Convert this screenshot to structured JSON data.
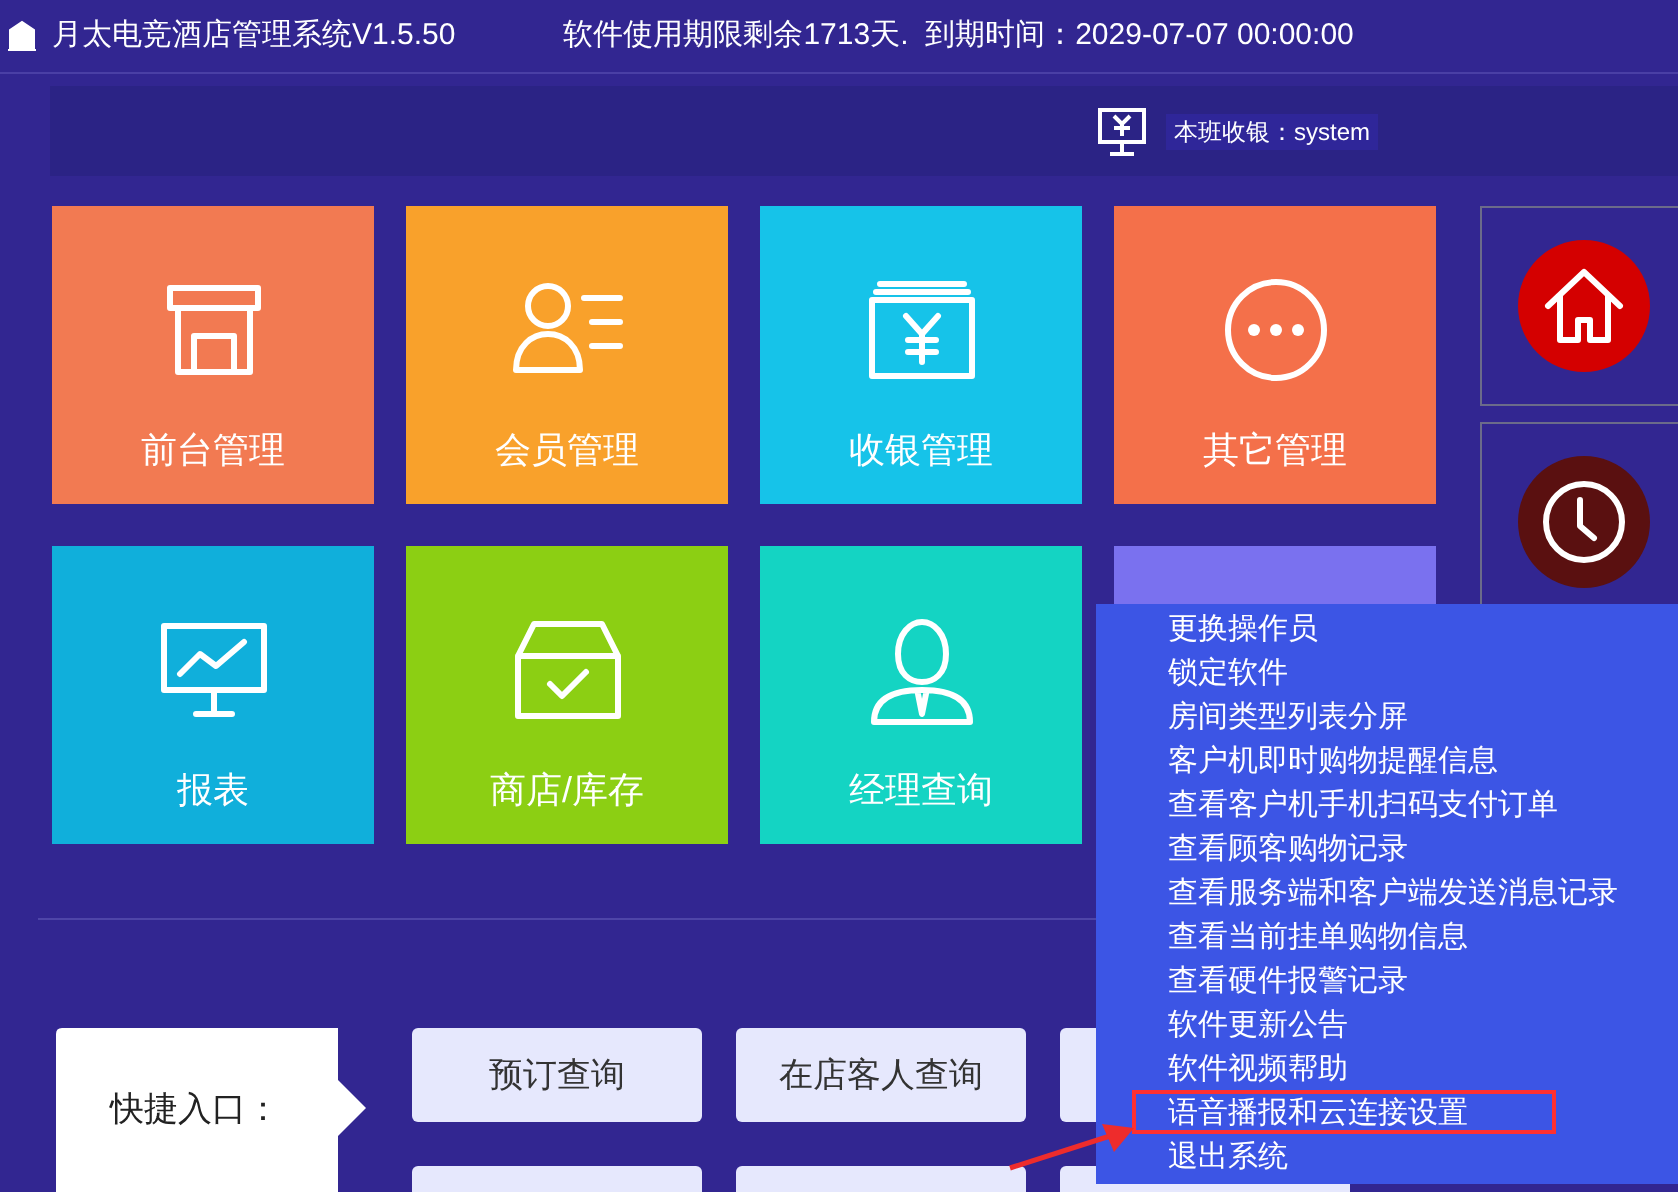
{
  "window": {
    "title": "月太电竞酒店管理系统V1.5.50",
    "license": "软件使用期限剩余1713天.  到期时间：2029-07-07 00:00:00"
  },
  "toolbar": {
    "cashier": "本班收银：system"
  },
  "tiles": [
    {
      "kind": "frontdesk",
      "label": "前台管理",
      "color": "#f27a52"
    },
    {
      "kind": "member",
      "label": "会员管理",
      "color": "#f9a12b"
    },
    {
      "kind": "cashier",
      "label": "收银管理",
      "color": "#16c3e9"
    },
    {
      "kind": "other",
      "label": "其它管理",
      "color": "#f4704a"
    },
    {
      "kind": "report",
      "label": "报表",
      "color": "#10afdb"
    },
    {
      "kind": "store",
      "label": "商店/库存",
      "color": "#8ccf13"
    },
    {
      "kind": "manager",
      "label": "经理查询",
      "color": "#14d4c3"
    },
    {
      "kind": "blank",
      "color": "#7a71ef"
    }
  ],
  "side_cards": [
    {
      "kind": "home",
      "color": "#d40000"
    },
    {
      "kind": "clock",
      "color": "#5a1010"
    }
  ],
  "quick_entry": {
    "label": "快捷入口：",
    "buttons": [
      "预订查询",
      "在店客人查询"
    ]
  },
  "menu": {
    "items": [
      {
        "label": "更换操作员",
        "highlighted": false
      },
      {
        "label": "锁定软件",
        "highlighted": false
      },
      {
        "label": "房间类型列表分屏",
        "highlighted": false
      },
      {
        "label": "客户机即时购物提醒信息",
        "highlighted": false
      },
      {
        "label": "查看客户机手机扫码支付订单",
        "highlighted": false
      },
      {
        "label": "查看顾客购物记录",
        "highlighted": false
      },
      {
        "label": "查看服务端和客户端发送消息记录",
        "highlighted": false
      },
      {
        "label": "查看当前挂单购物信息",
        "highlighted": false
      },
      {
        "label": "查看硬件报警记录",
        "highlighted": false
      },
      {
        "label": "软件更新公告",
        "highlighted": false
      },
      {
        "label": "软件视频帮助",
        "highlighted": false
      },
      {
        "label": "语音播报和云连接设置",
        "highlighted": true
      },
      {
        "label": "退出系统",
        "highlighted": false
      }
    ]
  }
}
